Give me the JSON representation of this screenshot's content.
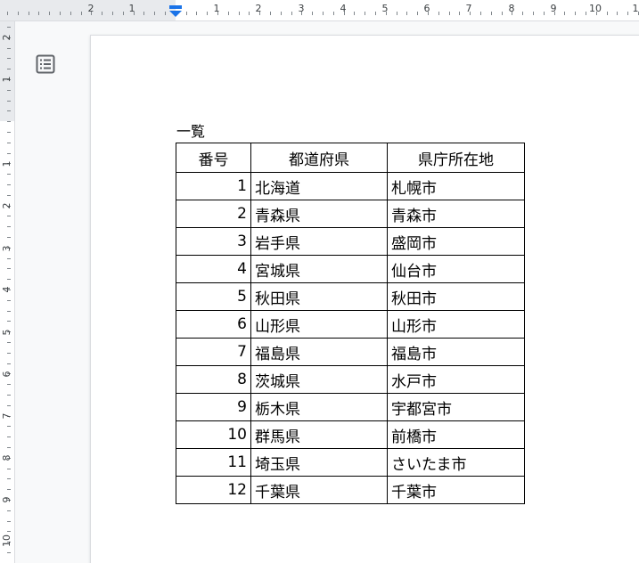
{
  "ruler": {
    "horizontal_labels": [
      "2",
      "1",
      "1",
      "2",
      "3",
      "4",
      "5",
      "6",
      "7",
      "8",
      "9",
      "10",
      "1"
    ],
    "vertical_labels": [
      "2",
      "1",
      "1",
      "2",
      "3",
      "4",
      "5",
      "6",
      "7",
      "8",
      "9",
      "10"
    ]
  },
  "outline_icon": "document-outline-icon",
  "document": {
    "heading": "一覧",
    "table": {
      "headers": [
        "番号",
        "都道府県",
        "県庁所在地"
      ],
      "rows": [
        [
          "1",
          "北海道",
          "札幌市"
        ],
        [
          "2",
          "青森県",
          "青森市"
        ],
        [
          "3",
          "岩手県",
          "盛岡市"
        ],
        [
          "4",
          "宮城県",
          "仙台市"
        ],
        [
          "5",
          "秋田県",
          "秋田市"
        ],
        [
          "6",
          "山形県",
          "山形市"
        ],
        [
          "7",
          "福島県",
          "福島市"
        ],
        [
          "8",
          "茨城県",
          "水戸市"
        ],
        [
          "9",
          "栃木県",
          "宇都宮市"
        ],
        [
          "10",
          "群馬県",
          "前橋市"
        ],
        [
          "11",
          "埼玉県",
          "さいたま市"
        ],
        [
          "12",
          "千葉県",
          "千葉市"
        ]
      ]
    }
  },
  "colors": {
    "ruler_background": "#f8f9fa",
    "margin_shade": "#e8eaed",
    "indent_marker": "#1a73e8",
    "text": "#000000"
  }
}
